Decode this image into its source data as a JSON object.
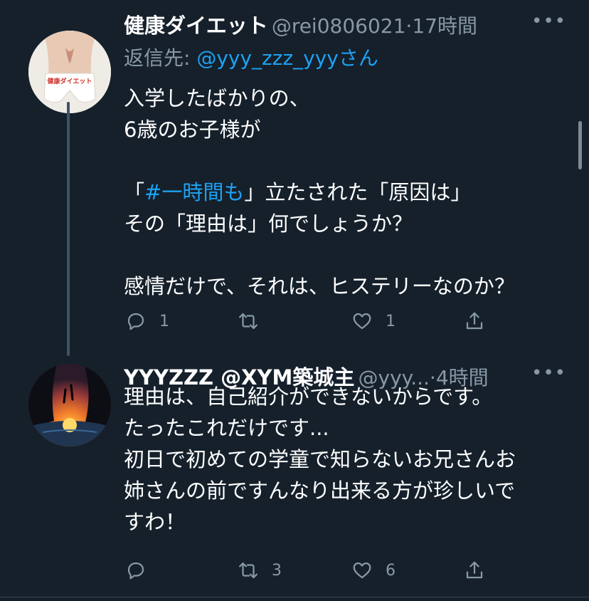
{
  "tweets": [
    {
      "name": "健康ダイエット",
      "handle": "@rei0806021",
      "separator": "·",
      "time": "17時間",
      "more": "•••",
      "reply_prefix": "返信先:",
      "reply_mention": "@yyy_zzz_yyyさん",
      "avatar_text": "健康ダイエット",
      "lines": [
        "入学したばかりの、",
        "6歳のお子様が",
        "",
        "",
        "その「理由は」何でしょうか？",
        "",
        "",
        "感情だけで、それは、ヒステリーなのか？"
      ],
      "line4_pre": "「",
      "line4_hashtag": "#一時間も",
      "line4_post": "」立たされた「原因は」",
      "reply_count": "1",
      "retweet_count": "",
      "like_count": "1"
    },
    {
      "name": "YYYZZZ @XYM築城主",
      "handle": "@yyy...",
      "separator": "·",
      "time": "4時間",
      "more": "•••",
      "lines": [
        "理由は、自己紹介ができないからです。",
        "たったこれだけです...",
        "初日で初めての学童で知らないお兄さんお",
        "姉さんの前ですんなり出来る方が珍しいで",
        "すわ！"
      ],
      "reply_count": "",
      "retweet_count": "3",
      "like_count": "6"
    }
  ],
  "colors": {
    "background": "#15202b",
    "text": "#ffffff",
    "secondary": "#8899a6",
    "accent": "#1da1f2",
    "thread_line": "#3d5466"
  },
  "icons": [
    "reply-icon",
    "retweet-icon",
    "like-icon",
    "share-icon",
    "more-icon"
  ]
}
